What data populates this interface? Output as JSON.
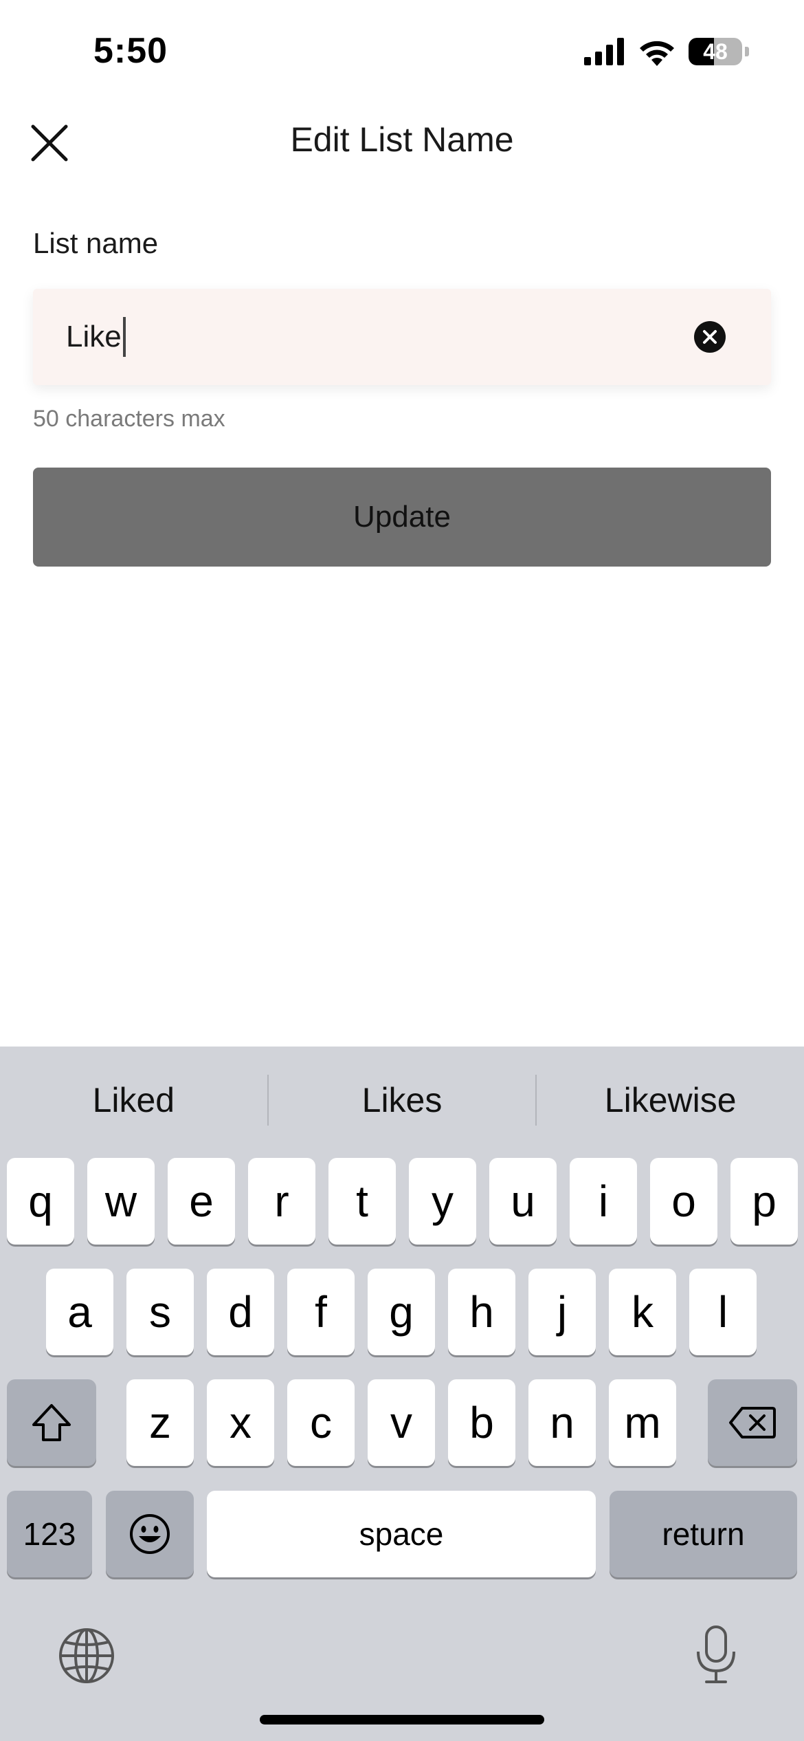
{
  "status_bar": {
    "time": "5:50",
    "battery_level": "48",
    "icons": [
      "cellular-signal-icon",
      "wifi-icon",
      "battery-icon"
    ]
  },
  "header": {
    "title": "Edit List Name",
    "close_icon": "close-icon"
  },
  "form": {
    "label": "List name",
    "input_value": "Like",
    "clear_icon": "clear-input-icon",
    "helper_text": "50 characters max",
    "submit_label": "Update"
  },
  "keyboard": {
    "suggestions": [
      "Liked",
      "Likes",
      "Likewise"
    ],
    "row1": [
      "q",
      "w",
      "e",
      "r",
      "t",
      "y",
      "u",
      "i",
      "o",
      "p"
    ],
    "row2": [
      "a",
      "s",
      "d",
      "f",
      "g",
      "h",
      "j",
      "k",
      "l"
    ],
    "row3": [
      "z",
      "x",
      "c",
      "v",
      "b",
      "n",
      "m"
    ],
    "numbers_label": "123",
    "space_label": "space",
    "return_label": "return",
    "icons": [
      "shift-icon",
      "backspace-icon",
      "emoji-icon",
      "globe-icon",
      "microphone-icon"
    ]
  },
  "colors": {
    "input_background": "#fbf3f1",
    "button_background": "#707070",
    "keyboard_background": "#d1d3d9"
  }
}
